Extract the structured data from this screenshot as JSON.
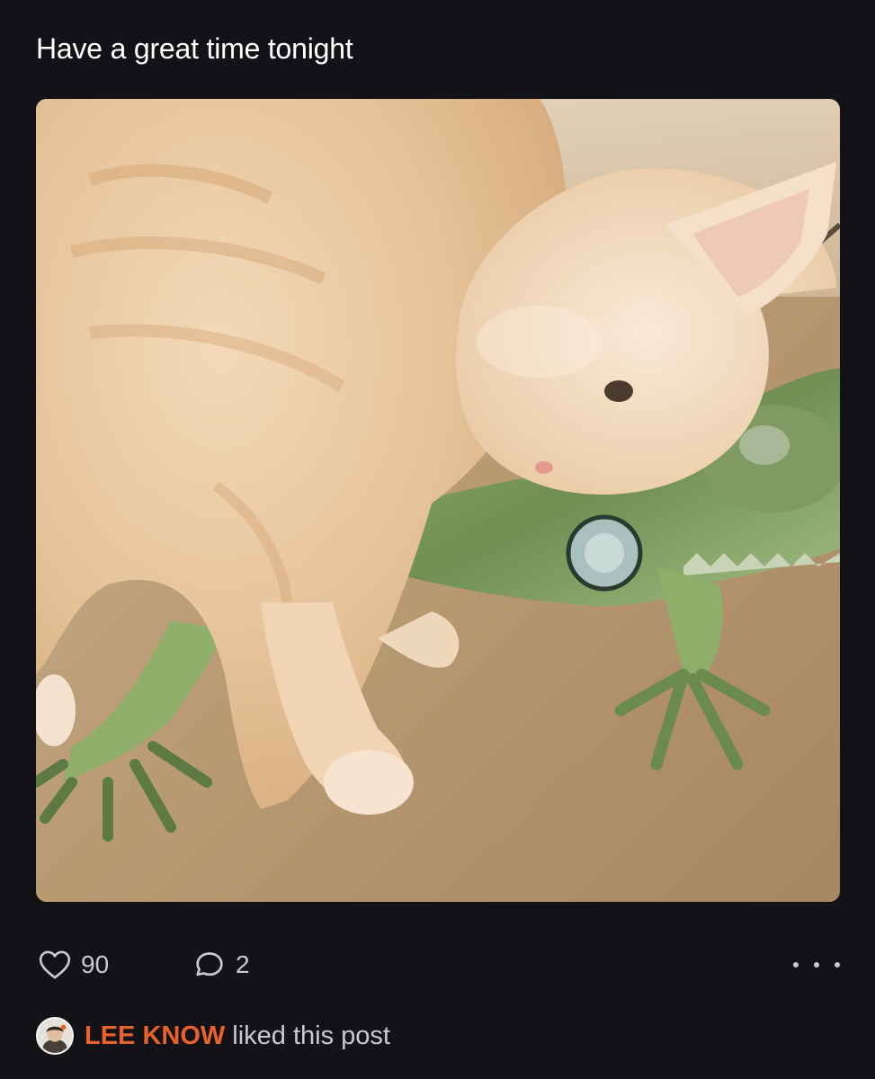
{
  "post": {
    "text": "Have a great time tonight",
    "media": {
      "icon": "photo-cat-and-iguana"
    },
    "actions": {
      "like_count": "90",
      "reply_count": "2",
      "like_icon": "heart-icon",
      "reply_icon": "comment-bubble-icon",
      "more_icon": "more-dots-icon"
    },
    "liked_by": {
      "name": "LEE KNOW",
      "text": "liked this post",
      "name_color": "#e8632b"
    }
  },
  "colors": {
    "background": "#121217",
    "text": "#ffffff",
    "muted": "#c9c9cf",
    "accent": "#e8632b"
  }
}
